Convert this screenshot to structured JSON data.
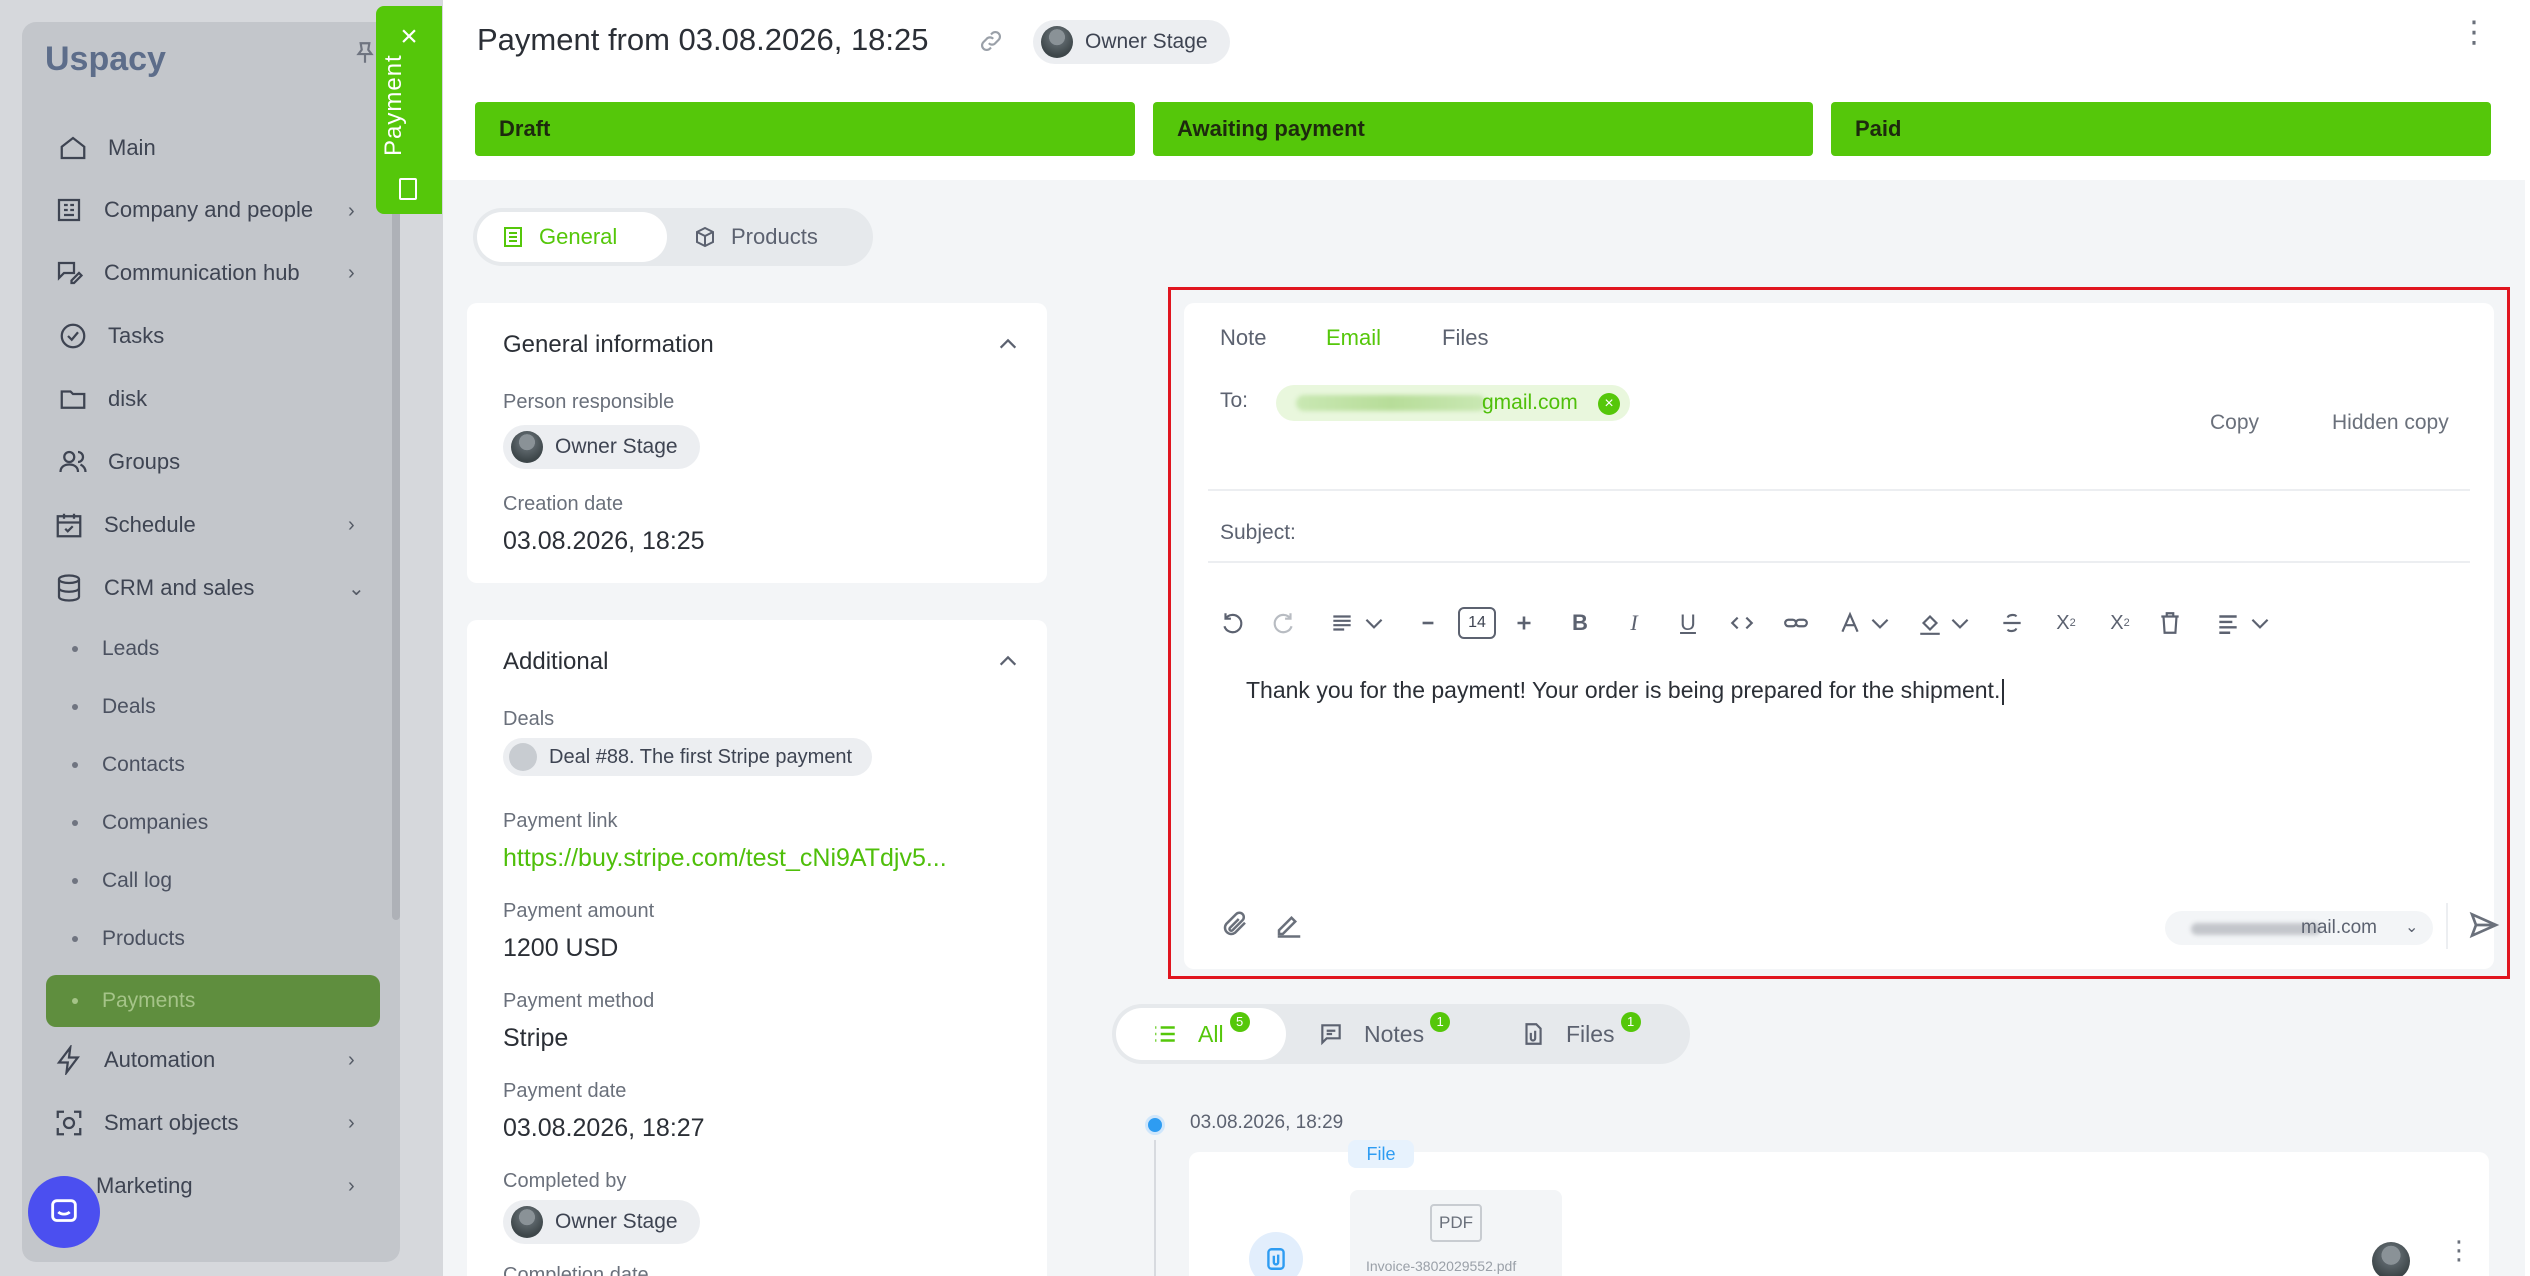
{
  "sidebar": {
    "logo": "Uspacy",
    "items": [
      {
        "label": "Main"
      },
      {
        "label": "Company and people"
      },
      {
        "label": "Communication hub"
      },
      {
        "label": "Tasks"
      },
      {
        "label": "disk"
      },
      {
        "label": "Groups"
      },
      {
        "label": "Schedule"
      },
      {
        "label": "CRM and sales"
      },
      {
        "label": "Automation"
      },
      {
        "label": "Smart objects"
      },
      {
        "label": "Marketing"
      }
    ],
    "crm_sub": [
      {
        "label": "Leads"
      },
      {
        "label": "Deals"
      },
      {
        "label": "Contacts"
      },
      {
        "label": "Companies"
      },
      {
        "label": "Call log"
      },
      {
        "label": "Products"
      },
      {
        "label": "Payments"
      }
    ]
  },
  "side_tab": {
    "label": "Payment"
  },
  "header": {
    "title": "Payment from 03.08.2026, 18:25",
    "owner": "Owner Stage",
    "stages": [
      "Draft",
      "Awaiting payment",
      "Paid"
    ]
  },
  "tabs": {
    "general": "General",
    "products": "Products"
  },
  "general_info": {
    "title": "General information",
    "person_label": "Person responsible",
    "person": "Owner Stage",
    "creation_label": "Creation date",
    "creation": "03.08.2026, 18:25"
  },
  "additional": {
    "title": "Additional",
    "deals_label": "Deals",
    "deal": "Deal #88. The first Stripe payment",
    "link_label": "Payment link",
    "link": "https://buy.stripe.com/test_cNi9ATdjv5...",
    "amount_label": "Payment amount",
    "amount": "1200 USD",
    "method_label": "Payment method",
    "method": "Stripe",
    "date_label": "Payment date",
    "date": "03.08.2026, 18:27",
    "completed_label": "Completed by",
    "completed": "Owner Stage",
    "completion_label": "Completion date"
  },
  "editor": {
    "tabs": [
      "Note",
      "Email",
      "Files"
    ],
    "to_label": "To:",
    "recipient": "gmail.com",
    "copy": "Copy",
    "hidden_copy": "Hidden copy",
    "subject_label": "Subject:",
    "font_size": "14",
    "body": "Thank you for the payment! Your order is being prepared for the shipment.",
    "from": "mail.com"
  },
  "feed": {
    "tabs": [
      {
        "label": "All",
        "count": "5"
      },
      {
        "label": "Notes",
        "count": "1"
      },
      {
        "label": "Files",
        "count": "1"
      }
    ],
    "date": "03.08.2026, 18:29",
    "tag": "File",
    "pdf": "PDF",
    "filename": "Invoice-3802029552.pdf"
  },
  "colors": {
    "accent": "#55c70a",
    "highlight": "#e0151f",
    "timeline": "#2e9cf2"
  }
}
